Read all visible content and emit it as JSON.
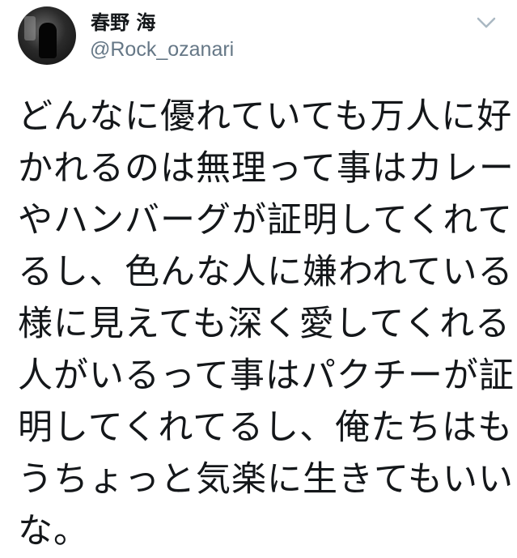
{
  "user": {
    "display_name": "春野 海",
    "handle": "@Rock_ozanari"
  },
  "menu": {
    "icon": "chevron-down-icon",
    "color": "#aab8c2"
  },
  "tweet": {
    "lines": [
      "どんなに優れていても万人に好",
      "かれるのは無理って事はカレー",
      "やハンバーグが証明してくれて",
      "るし、色んな人に嫌われている",
      "様に見えても深く愛してくれる",
      "人がいるって事はパクチーが証",
      "明してくれてるし、俺たちはも",
      "うちょっと気楽に生きてもいい",
      "な。"
    ]
  },
  "colors": {
    "text": "#14171a",
    "secondary_text": "#657786",
    "background": "#ffffff"
  }
}
